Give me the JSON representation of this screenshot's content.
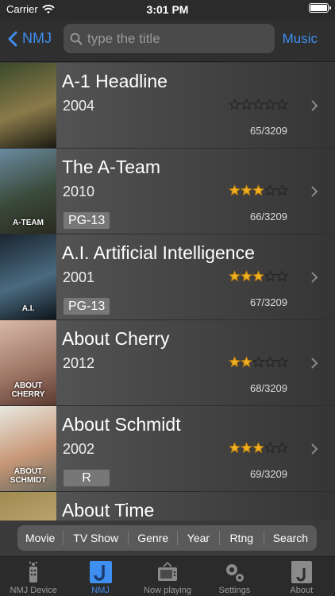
{
  "status": {
    "carrier": "Carrier",
    "time": "3:01 PM"
  },
  "nav": {
    "back_label": "NMJ",
    "search_placeholder": "type the title",
    "music_label": "Music"
  },
  "movies": [
    {
      "title": "A-1 Headline",
      "year": "2004",
      "rating": 0,
      "badge": "",
      "count": "65/3209",
      "poster_caption": "",
      "poster_colors": [
        "#3a4a2a",
        "#8a7a4a",
        "#1a1a12"
      ]
    },
    {
      "title": "The A-Team",
      "year": "2010",
      "rating": 3,
      "badge": "PG-13",
      "count": "66/3209",
      "poster_caption": "A-TEAM",
      "poster_colors": [
        "#6a8aa0",
        "#3a4a3a",
        "#2a2a20"
      ]
    },
    {
      "title": "A.I. Artificial Intelligence",
      "year": "2001",
      "rating": 3,
      "badge": "PG-13",
      "count": "67/3209",
      "poster_caption": "A.I.",
      "poster_colors": [
        "#1a2630",
        "#4a6a80",
        "#0e141a"
      ]
    },
    {
      "title": "About Cherry",
      "year": "2012",
      "rating": 2,
      "badge": "",
      "count": "68/3209",
      "poster_caption": "ABOUT CHERRY",
      "poster_colors": [
        "#d8b8a8",
        "#a07868",
        "#5a3a30"
      ]
    },
    {
      "title": "About Schmidt",
      "year": "2002",
      "rating": 3,
      "badge": "R",
      "count": "69/3209",
      "poster_caption": "ABOUT SCHMIDT",
      "poster_colors": [
        "#e8e8e0",
        "#c89878",
        "#6a6a60"
      ]
    },
    {
      "title": "About Time",
      "year": "",
      "rating": 0,
      "badge": "",
      "count": "",
      "poster_caption": "",
      "poster_colors": [
        "#a08a50",
        "#c0a870",
        "#6a5a30"
      ]
    }
  ],
  "filters": [
    "Movie",
    "TV Show",
    "Genre",
    "Year",
    "Rtng",
    "Search"
  ],
  "tabs": [
    {
      "label": "NMJ Device",
      "icon": "device-icon",
      "active": false
    },
    {
      "label": "NMJ",
      "icon": "nmj-j-icon",
      "active": true
    },
    {
      "label": "Now playing",
      "icon": "tv-icon",
      "active": false
    },
    {
      "label": "Settings",
      "icon": "gear-icon",
      "active": false
    },
    {
      "label": "About",
      "icon": "about-nmj-icon",
      "active": false
    }
  ],
  "colors": {
    "accent": "#3f8ff0",
    "star": "#f0b020"
  }
}
